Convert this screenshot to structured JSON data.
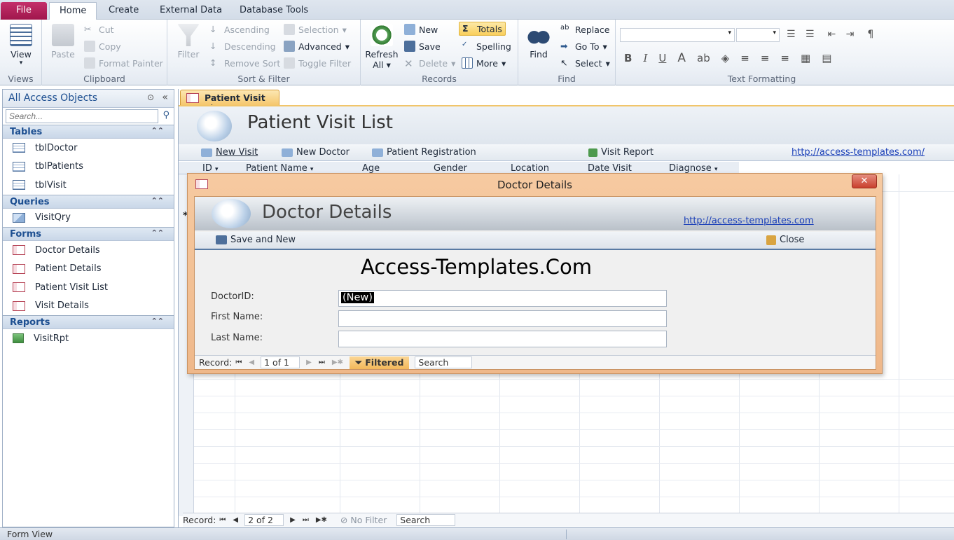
{
  "ribbon_tabs": [
    "File",
    "Home",
    "Create",
    "External Data",
    "Database Tools"
  ],
  "groups": {
    "views": {
      "label": "Views",
      "view": "View"
    },
    "clipboard": {
      "label": "Clipboard",
      "paste": "Paste",
      "cut": "Cut",
      "copy": "Copy",
      "format_painter": "Format Painter"
    },
    "sort_filter": {
      "label": "Sort & Filter",
      "filter": "Filter",
      "ascending": "Ascending",
      "descending": "Descending",
      "remove_sort": "Remove Sort",
      "selection": "Selection",
      "advanced": "Advanced",
      "toggle_filter": "Toggle Filter"
    },
    "records": {
      "label": "Records",
      "refresh": "Refresh",
      "refresh_all": "All",
      "new": "New",
      "save": "Save",
      "delete": "Delete",
      "totals": "Totals",
      "spelling": "Spelling",
      "more": "More"
    },
    "find": {
      "label": "Find",
      "find": "Find",
      "replace": "Replace",
      "go_to": "Go To",
      "select": "Select"
    },
    "text_formatting": {
      "label": "Text Formatting",
      "bold": "B",
      "italic": "I",
      "underline": "U",
      "font_color": "A"
    }
  },
  "nav": {
    "title": "All Access Objects",
    "search_placeholder": "Search...",
    "sections": [
      {
        "title": "Tables",
        "items": [
          "tblDoctor",
          "tblPatients",
          "tblVisit"
        ]
      },
      {
        "title": "Queries",
        "items": [
          "VisitQry"
        ]
      },
      {
        "title": "Forms",
        "items": [
          "Doctor Details",
          "Patient Details",
          "Patient Visit List",
          "Visit Details"
        ]
      },
      {
        "title": "Reports",
        "items": [
          "VisitRpt"
        ]
      }
    ]
  },
  "doc": {
    "tab": "Patient Visit List",
    "title": "Patient Visit List",
    "commands": {
      "new_visit": "New Visit",
      "new_doctor": "New Doctor",
      "patient_registration": "Patient Registration",
      "visit_report": "Visit Report",
      "link": "http://access-templates.com/"
    },
    "columns": [
      "ID",
      "Patient Name",
      "Age",
      "Gender",
      "Location",
      "Date Visit",
      "Diagnose"
    ],
    "new_row_marker": "*",
    "record_nav": {
      "label": "Record:",
      "position": "2 of 2",
      "filter": "No Filter",
      "search": "Search"
    }
  },
  "dialog": {
    "window_title": "Doctor Details",
    "close_x": "✕",
    "header_title": "Doctor Details",
    "link": "http://access-templates.com",
    "save_and_new": "Save and New",
    "close": "Close",
    "banner": "Access-Templates.Com",
    "fields": [
      {
        "label": "DoctorID:",
        "value": "(New)"
      },
      {
        "label": "First Name:",
        "value": ""
      },
      {
        "label": "Last Name:",
        "value": ""
      }
    ],
    "record_nav": {
      "label": "Record:",
      "position": "1 of 1",
      "filter": "Filtered",
      "search": "Search"
    }
  },
  "status_bar": "Form View"
}
